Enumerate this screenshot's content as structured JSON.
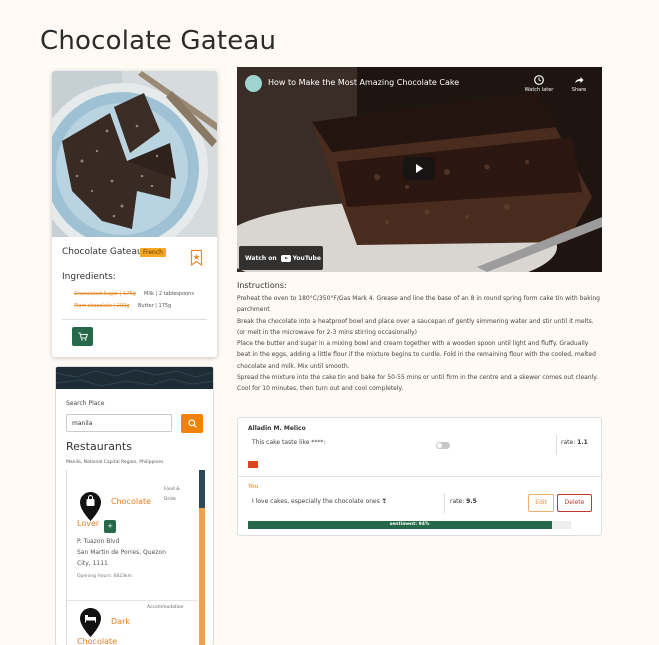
{
  "page": {
    "title": "Chocolate Gateau"
  },
  "recipe_card": {
    "name": "Chocolate Gateau",
    "cuisine": "French",
    "ingredients_label": "Ingredients:",
    "ingredients_struck": [
      "Granulated Sugar | 175g",
      "Plain chocolate | 200g"
    ],
    "ingredients": [
      "Milk | 2 tablespoons",
      "Butter | 175g"
    ],
    "accent_color": "#26694a"
  },
  "video": {
    "title": "How to Make the Most Amazing Chocolate Cake",
    "watch_later": "Watch later",
    "share": "Share",
    "watch_on": "Watch on",
    "youtube": "YouTube"
  },
  "instructions": {
    "label": "Instructions:",
    "body": "Preheat the oven to 180°C/350°F/Gas Mark 4. Grease and line the base of an 8 in round spring form cake tin with baking parchment\nBreak the chocolate into a heatproof bowl and place over a saucepan of gently simmering water and stir until it melts. (or melt in the microwave for 2-3 mins stirring occasionally)\nPlace the butter and sugar in a mixing bowl and cream together with a wooden spoon until light and fluffy. Gradually beat in the eggs, adding a little flour if the mixture begins to curdle. Fold in the remaining flour with the cooled, melted chocolate and milk. Mix until smooth.\nSpread the mixture into the cake tin and bake for 50-55 mins or until firm in the centre and a skewer comes out cleanly. Cool for 10 minutes, then turn out and cool completely."
  },
  "places": {
    "search_label": "Search Place",
    "search_value": "manila",
    "heading": "Restaurants",
    "location": "Manila, National Capital Region, Philippines",
    "results": [
      {
        "name_line1": "Chocolate",
        "name_line2": "Lover",
        "category_line1": "Food &",
        "category_line2": "Drink",
        "add_label": "+",
        "address_line1": "P. Tuazon Blvd",
        "address_line2": "San Martin de Porres, Quezon",
        "address_line3": "City, 1111",
        "hours": "Opening Hours: 6823km"
      },
      {
        "name_line1": "Dark",
        "name_line2": "Chocolate",
        "category_line1": "Accommodation"
      }
    ]
  },
  "reviews": [
    {
      "author": "Alladin M. Melico",
      "text": "This cake taste like ****:",
      "rate_label": "rate:",
      "rate_value": "1.1"
    },
    {
      "author": "You",
      "text": "I love cakes, especially the chocolate ones ❣",
      "rate_label": "rate:",
      "rate_value": "9.5",
      "edit_label": "Edit",
      "delete_label": "Delete",
      "sentiment_text": "sentiment: 94%",
      "sentiment_fraction": 0.94
    }
  ],
  "colors": {
    "background": "#fffaf5",
    "primary_green": "#26694a",
    "orange": "#f0820a",
    "map_header": "#1e2d35"
  }
}
